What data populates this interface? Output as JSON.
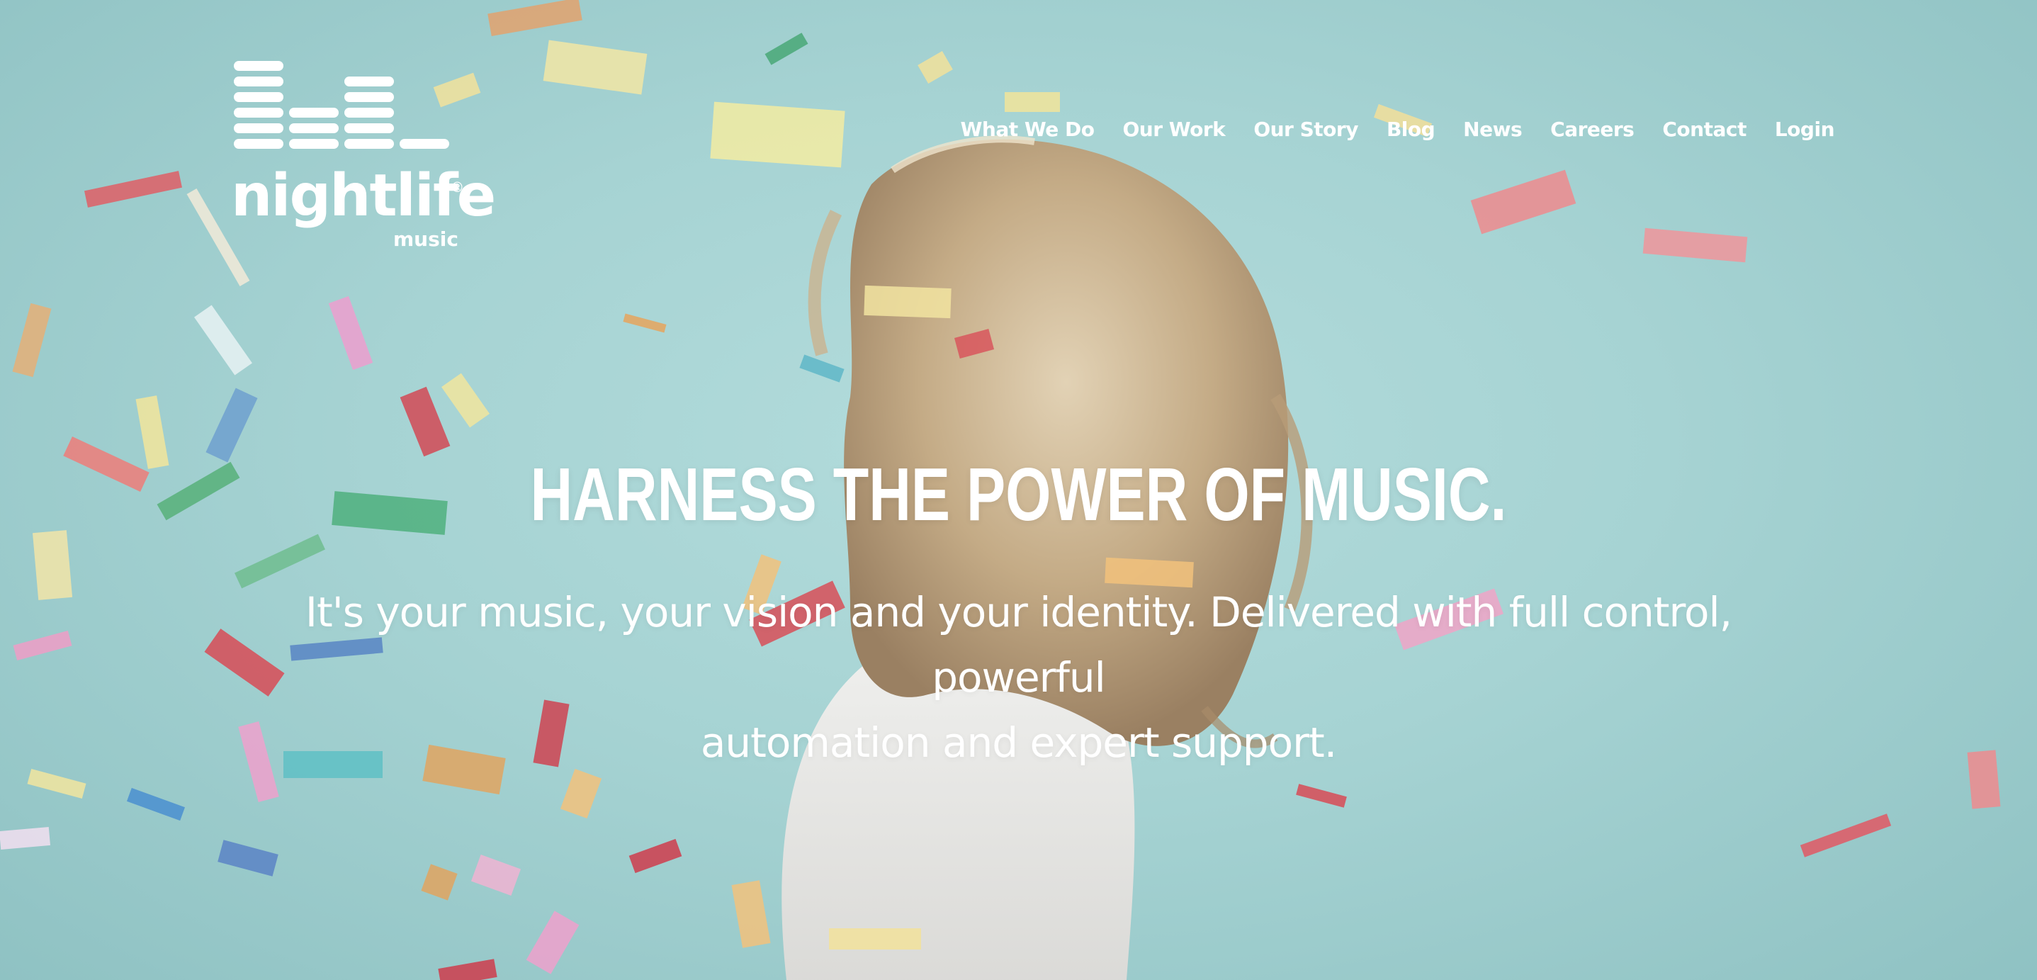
{
  "brand": {
    "wordmark": "nightlife",
    "registered_mark": "®",
    "submark": "music",
    "colors": {
      "text": "#ffffff",
      "background": "#a6d3d3"
    }
  },
  "nav": {
    "items": [
      {
        "label": "What We Do"
      },
      {
        "label": "Our Work"
      },
      {
        "label": "Our Story"
      },
      {
        "label": "Blog"
      },
      {
        "label": "News"
      },
      {
        "label": "Careers"
      },
      {
        "label": "Contact"
      },
      {
        "label": "Login"
      }
    ]
  },
  "hero": {
    "headline": "HARNESS THE POWER OF MUSIC.",
    "subline_1": "It's your music, your vision and your identity. Delivered with full control, powerful",
    "subline_2": "automation and expert support.",
    "background_image": "woman-hair-confetti-photo"
  }
}
